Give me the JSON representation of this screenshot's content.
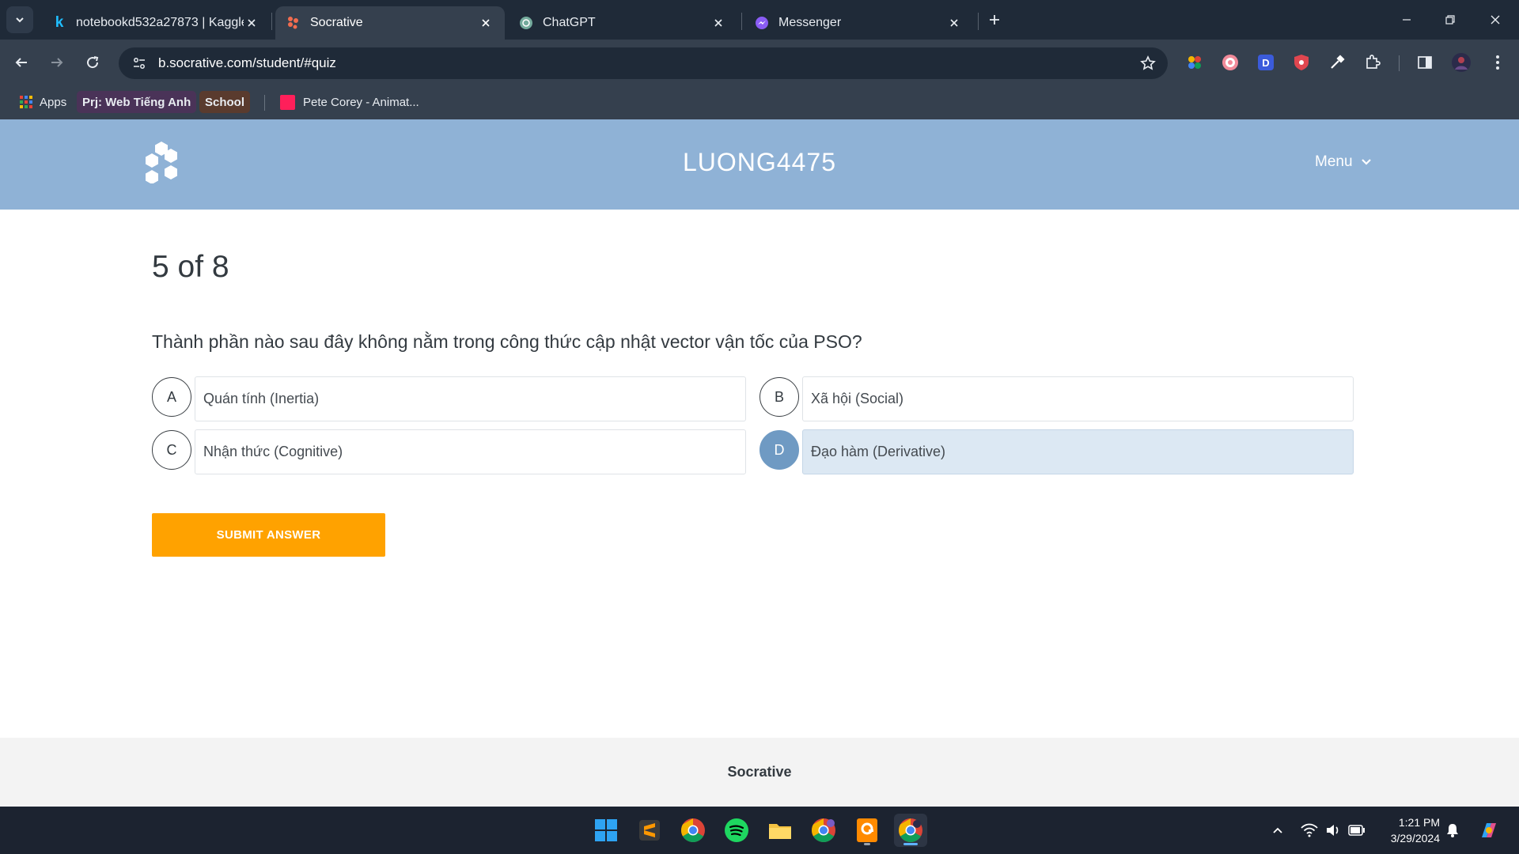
{
  "browser": {
    "tabs": [
      {
        "title": "notebookd532a27873 | Kaggle",
        "icon": "kaggle-icon",
        "active": false
      },
      {
        "title": "Socrative",
        "icon": "socrative-icon",
        "active": true
      },
      {
        "title": "ChatGPT",
        "icon": "chatgpt-icon",
        "active": false
      },
      {
        "title": "Messenger",
        "icon": "messenger-icon",
        "active": false
      }
    ],
    "url": "b.socrative.com/student/#quiz",
    "bookmarks": {
      "apps": "Apps",
      "web_tieng_anh": "Prj: Web Tiếng Anh",
      "school": "School",
      "pete_corey": "Pete Corey - Animat..."
    },
    "extension_icons": [
      "colorful-extension-icon",
      "record-extension-icon",
      "d-extension-icon",
      "shield-extension-icon",
      "eyedropper-extension-icon",
      "puzzle-extensions-icon",
      "side-panel-icon",
      "profile-avatar-icon",
      "more-menu-icon"
    ],
    "colors": {
      "tabbar": "#1f2a38",
      "toolbar": "#35404e",
      "web_tieng_anh_chip": "#4a3358",
      "school_chip": "#5a3b2e"
    }
  },
  "app": {
    "room_name": "LUONG4475",
    "menu_label": "Menu",
    "header_color": "#8fb2d6"
  },
  "quiz": {
    "progress": "5 of 8",
    "question": "Thành phần nào sau đây không nằm trong công thức cập nhật vector vận tốc của PSO?",
    "options": [
      {
        "letter": "A",
        "text": "Quán tính (Inertia)",
        "selected": false
      },
      {
        "letter": "B",
        "text": "Xã hội (Social)",
        "selected": false
      },
      {
        "letter": "C",
        "text": "Nhận thức (Cognitive)",
        "selected": false
      },
      {
        "letter": "D",
        "text": "Đạo hàm (Derivative)",
        "selected": true
      }
    ],
    "submit_label": "SUBMIT ANSWER",
    "submit_color": "#ffa200",
    "selected_color": "#6f9ac3"
  },
  "footer": {
    "brand": "Socrative"
  },
  "taskbar": {
    "apps": [
      "windows-start-icon",
      "sublime-text-icon",
      "chrome-icon",
      "spotify-icon",
      "file-explorer-icon",
      "chrome-profile-icon",
      "pdf-app-icon",
      "chrome-active-icon"
    ],
    "time": "1:21 PM",
    "date": "3/29/2024"
  }
}
